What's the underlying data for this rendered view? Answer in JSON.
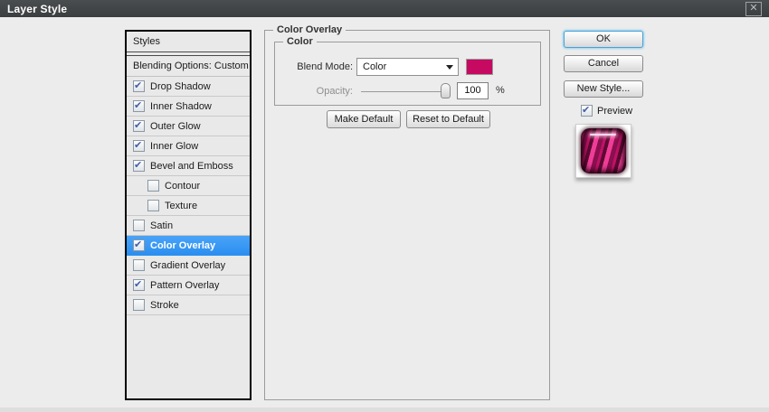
{
  "window": {
    "title": "Layer Style"
  },
  "icons": {
    "close": "✕",
    "check": "✔"
  },
  "styles_panel": {
    "header": "Styles",
    "blending_row": "Blending Options: Custom",
    "items": [
      {
        "label": "Drop Shadow",
        "checked": true,
        "indent": false,
        "selected": false
      },
      {
        "label": "Inner Shadow",
        "checked": true,
        "indent": false,
        "selected": false
      },
      {
        "label": "Outer Glow",
        "checked": true,
        "indent": false,
        "selected": false
      },
      {
        "label": "Inner Glow",
        "checked": true,
        "indent": false,
        "selected": false
      },
      {
        "label": "Bevel and Emboss",
        "checked": true,
        "indent": false,
        "selected": false
      },
      {
        "label": "Contour",
        "checked": false,
        "indent": true,
        "selected": false
      },
      {
        "label": "Texture",
        "checked": false,
        "indent": true,
        "selected": false
      },
      {
        "label": "Satin",
        "checked": false,
        "indent": false,
        "selected": false
      },
      {
        "label": "Color Overlay",
        "checked": true,
        "indent": false,
        "selected": true
      },
      {
        "label": "Gradient Overlay",
        "checked": false,
        "indent": false,
        "selected": false
      },
      {
        "label": "Pattern Overlay",
        "checked": true,
        "indent": false,
        "selected": false
      },
      {
        "label": "Stroke",
        "checked": false,
        "indent": false,
        "selected": false
      }
    ]
  },
  "main_panel": {
    "group_title": "Color Overlay",
    "inner_group_title": "Color",
    "blend_mode_label": "Blend Mode:",
    "blend_mode_value": "Color",
    "opacity_label": "Opacity:",
    "opacity_value": "100",
    "opacity_unit": "%",
    "make_default_label": "Make Default",
    "reset_default_label": "Reset to Default"
  },
  "actions": {
    "ok_label": "OK",
    "cancel_label": "Cancel",
    "new_style_label": "New Style...",
    "preview_label": "Preview"
  },
  "colors": {
    "titlebar": "#3b3e40",
    "dialog_bg": "#ececec",
    "selection_blue": "#2f95f2",
    "swatch_pink": "#c60a62"
  }
}
